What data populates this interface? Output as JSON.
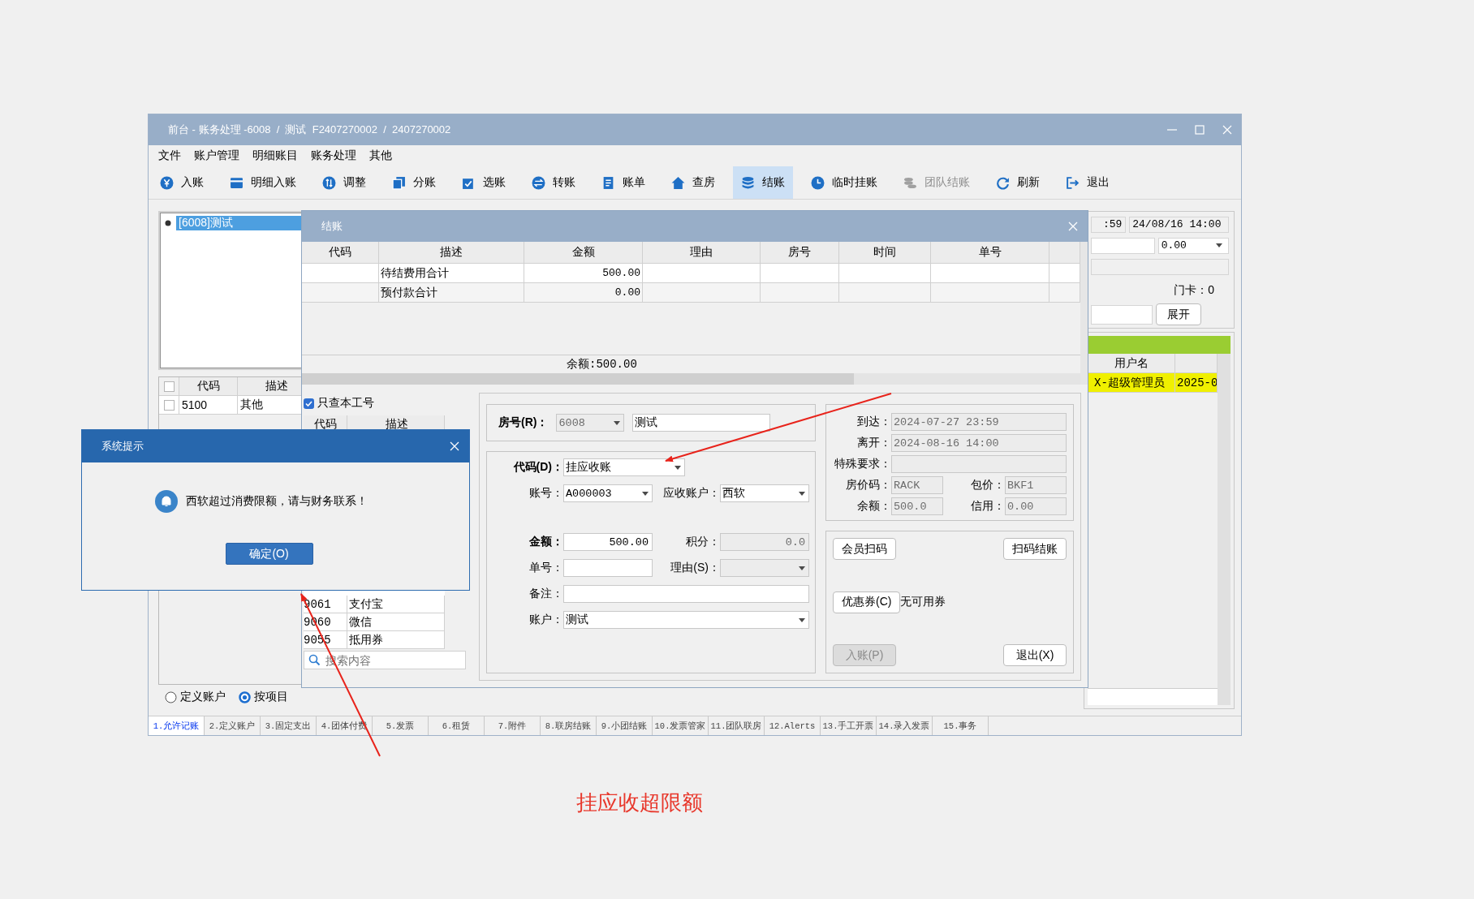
{
  "main_window": {
    "title": "前台 - 账务处理 -6008  /  测试  F2407270002  /  2407270002",
    "menu": [
      "文件",
      "账户管理",
      "明细账目",
      "账务处理",
      "其他"
    ],
    "toolbar": [
      {
        "label": "入账",
        "selected": false,
        "disabled": false
      },
      {
        "label": "明细入账",
        "selected": false,
        "disabled": false
      },
      {
        "label": "调整",
        "selected": false,
        "disabled": false
      },
      {
        "label": "分账",
        "selected": false,
        "disabled": false
      },
      {
        "label": "选账",
        "selected": false,
        "disabled": false
      },
      {
        "label": "转账",
        "selected": false,
        "disabled": false
      },
      {
        "label": "账单",
        "selected": false,
        "disabled": false
      },
      {
        "label": "查房",
        "selected": false,
        "disabled": false
      },
      {
        "label": "结账",
        "selected": true,
        "disabled": false
      },
      {
        "label": "临时挂账",
        "selected": false,
        "disabled": false
      },
      {
        "label": "团队结账",
        "selected": false,
        "disabled": true
      },
      {
        "label": "刷新",
        "selected": false,
        "disabled": false
      },
      {
        "label": "退出",
        "selected": false,
        "disabled": false
      }
    ],
    "guest_list": [
      {
        "label": "[6008]测试",
        "selected": true
      }
    ],
    "item_table": {
      "header_checked": false,
      "columns": [
        "代码",
        "描述"
      ],
      "rows": [
        {
          "checked": false,
          "code": "5100",
          "name": "其他"
        }
      ]
    },
    "view_options": [
      {
        "label": "定义账户",
        "selected": false
      },
      {
        "label": "按项目",
        "selected": true
      }
    ],
    "stay_panel": {
      "arrival": ":59",
      "departure": "24/08/16 14:00",
      "amount": "0.00",
      "card": "门卡：0",
      "expand_button": "展开"
    },
    "user_table": {
      "columns": [
        "用户名"
      ],
      "rows": [
        {
          "selected": true,
          "user": "X-超级管理员",
          "time": "2025-0"
        }
      ]
    },
    "tabs": [
      {
        "label": "1.允许记账",
        "selected": true
      },
      {
        "label": "2.定义账户",
        "selected": false
      },
      {
        "label": "3.固定支出",
        "selected": false
      },
      {
        "label": "4.团体付费",
        "selected": false
      },
      {
        "label": "5.发票",
        "selected": false
      },
      {
        "label": "6.租赁",
        "selected": false
      },
      {
        "label": "7.附件",
        "selected": false
      },
      {
        "label": "8.联房结账",
        "selected": false
      },
      {
        "label": "9.小团结账",
        "selected": false
      },
      {
        "label": "10.发票管家",
        "selected": false
      },
      {
        "label": "11.团队联房",
        "selected": false
      },
      {
        "label": "12.Alerts",
        "selected": false
      },
      {
        "label": "13.手工开票",
        "selected": false
      },
      {
        "label": "14.录入发票",
        "selected": false
      },
      {
        "label": "15.事务",
        "selected": false
      }
    ]
  },
  "checkout_dialog": {
    "title": "结账",
    "table": {
      "columns": [
        "代码",
        "描述",
        "金额",
        "理由",
        "房号",
        "时间",
        "单号"
      ],
      "rows": [
        {
          "description": "待结费用合计",
          "amount": "500.00"
        },
        {
          "description": "预付款合计",
          "amount": "0.00"
        }
      ],
      "footer": "余额:500.00"
    },
    "only_mine": {
      "label": "只查本工号",
      "checked": true
    },
    "payment_table": {
      "columns": [
        "代码",
        "描述"
      ],
      "rows": [
        {
          "code": "9061",
          "name": "支付宝"
        },
        {
          "code": "9060",
          "name": "微信"
        },
        {
          "code": "9055",
          "name": "抵用券"
        }
      ]
    },
    "search": {
      "placeholder": "搜索内容"
    },
    "room": {
      "label": "房号(R)：",
      "bold": true,
      "code": {
        "value": "6008",
        "kind": "dropdown",
        "disabled": true
      },
      "name": {
        "value": "测试",
        "disabled": false
      }
    },
    "code": {
      "label": "代码(D)：",
      "bold": true,
      "field": {
        "value": "挂应收账",
        "kind": "dropdown",
        "disabled": false
      }
    },
    "entry_rows": [
      {
        "items": [
          {
            "label": "账号：",
            "bold": false,
            "field": {
              "value": "A000003",
              "kind": "dropdown",
              "disabled": false
            }
          },
          {
            "label": "应收账户：",
            "bold": false,
            "field": {
              "value": "西软",
              "kind": "dropdown",
              "disabled": false
            }
          }
        ]
      },
      {
        "items": [
          {
            "label": "金额：",
            "bold": true,
            "field": {
              "value": "500.00",
              "kind": "number",
              "disabled": false
            }
          },
          {
            "label": "积分：",
            "bold": false,
            "field": {
              "value": "0.0",
              "kind": "number",
              "disabled": true
            }
          }
        ]
      },
      {
        "items": [
          {
            "label": "单号：",
            "bold": false,
            "field": {
              "disabled": false
            }
          },
          {
            "label": "理由(S)：",
            "bold": false,
            "field": {
              "kind": "dropdown",
              "disabled": true
            }
          }
        ]
      },
      {
        "items": [
          {
            "label": "备注：",
            "bold": false,
            "field": {
              "disabled": false
            }
          }
        ]
      },
      {
        "items": [
          {
            "label": "账户：",
            "bold": false,
            "field": {
              "value": "测试",
              "kind": "dropdown",
              "disabled": false
            }
          }
        ]
      }
    ],
    "info_rows": [
      {
        "items": [
          {
            "label": "到达：",
            "field": {
              "value": "2024-07-27 23:59",
              "disabled": true
            }
          }
        ]
      },
      {
        "items": [
          {
            "label": "离开：",
            "field": {
              "value": "2024-08-16 14:00",
              "disabled": true
            }
          }
        ]
      },
      {
        "items": [
          {
            "label": "特殊要求：",
            "field": {
              "disabled": true
            }
          }
        ]
      },
      {
        "items": [
          {
            "label": "房价码：",
            "field": {
              "value": "RACK",
              "disabled": true
            }
          },
          {
            "label": "包价：",
            "field": {
              "value": "BKF1",
              "disabled": true
            }
          }
        ]
      },
      {
        "items": [
          {
            "label": "余额：",
            "field": {
              "value": "500.0",
              "disabled": true
            }
          },
          {
            "label": "信用：",
            "field": {
              "value": "0.00",
              "disabled": true
            }
          }
        ]
      }
    ],
    "buttons": [
      {
        "label": "会员扫码",
        "disabled": false
      },
      {
        "label": "扫码结账",
        "disabled": false
      },
      {
        "label": "优惠券(C)",
        "disabled": false
      },
      {
        "label": "入账(P)",
        "disabled": true
      },
      {
        "label": "退出(X)",
        "disabled": false
      }
    ],
    "coupon_note": "无可用券"
  },
  "alert_dialog": {
    "title": "系统提示",
    "message": "西软超过消费限额，请与财务联系！",
    "button": "确定(O)"
  },
  "annotation": {
    "caption": "挂应收超限额"
  }
}
